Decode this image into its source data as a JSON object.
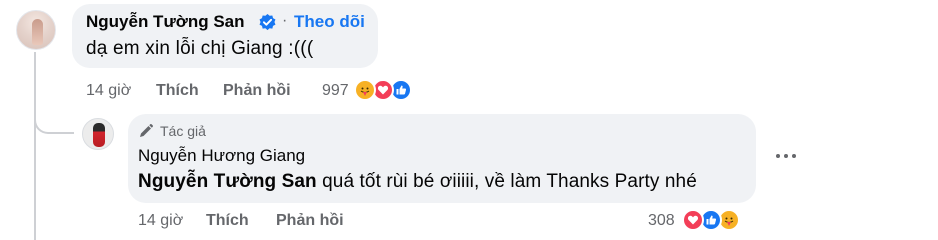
{
  "comment": {
    "author": "Nguyễn Tường San",
    "follow_separator": "·",
    "follow_label": "Theo dõi",
    "text": "dạ em xin lỗi chị Giang :(((",
    "time": "14 giờ",
    "like_label": "Thích",
    "reply_label": "Phản hồi",
    "reaction_count": "997",
    "reactions": [
      "care-icon",
      "love-icon",
      "like-icon"
    ]
  },
  "reply": {
    "badge": "Tác giả",
    "author": "Nguyễn Hương Giang",
    "mention": "Nguyễn Tường San",
    "text": " quá tốt rùi bé ơiiiii, về làm Thanks Party nhé",
    "time": "14 giờ",
    "like_label": "Thích",
    "reply_label": "Phản hồi",
    "reaction_count": "308",
    "reactions": [
      "love-icon",
      "like-icon",
      "care-icon"
    ]
  },
  "colors": {
    "accent": "#1877f2",
    "bubble": "#f0f2f5",
    "secondary_text": "#65676b",
    "love": "#f33e58",
    "care": "#f7b125"
  }
}
